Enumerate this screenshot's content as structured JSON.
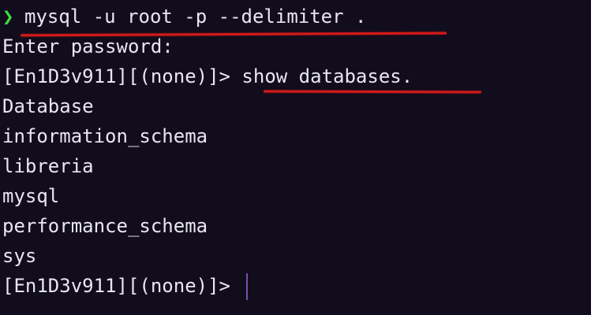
{
  "terminal": {
    "lines": [
      {
        "prompt_symbol": "❯",
        "text": "mysql -u root -p --delimiter ."
      },
      {
        "text": "Enter password:"
      },
      {
        "text": "[En1D3v911][(none)]> show databases."
      },
      {
        "text": "Database"
      },
      {
        "text": "information_schema"
      },
      {
        "text": "libreria"
      },
      {
        "text": "mysql"
      },
      {
        "text": "performance_schema"
      },
      {
        "text": "sys"
      },
      {
        "text": "[En1D3v911][(none)]> "
      }
    ]
  },
  "colors": {
    "background": "#110d1d",
    "foreground": "#e9e6ef",
    "prompt_chevron": "#3fdc3f",
    "annotation_underline": "#d51a1a",
    "cursor": "#7a4fb0"
  }
}
